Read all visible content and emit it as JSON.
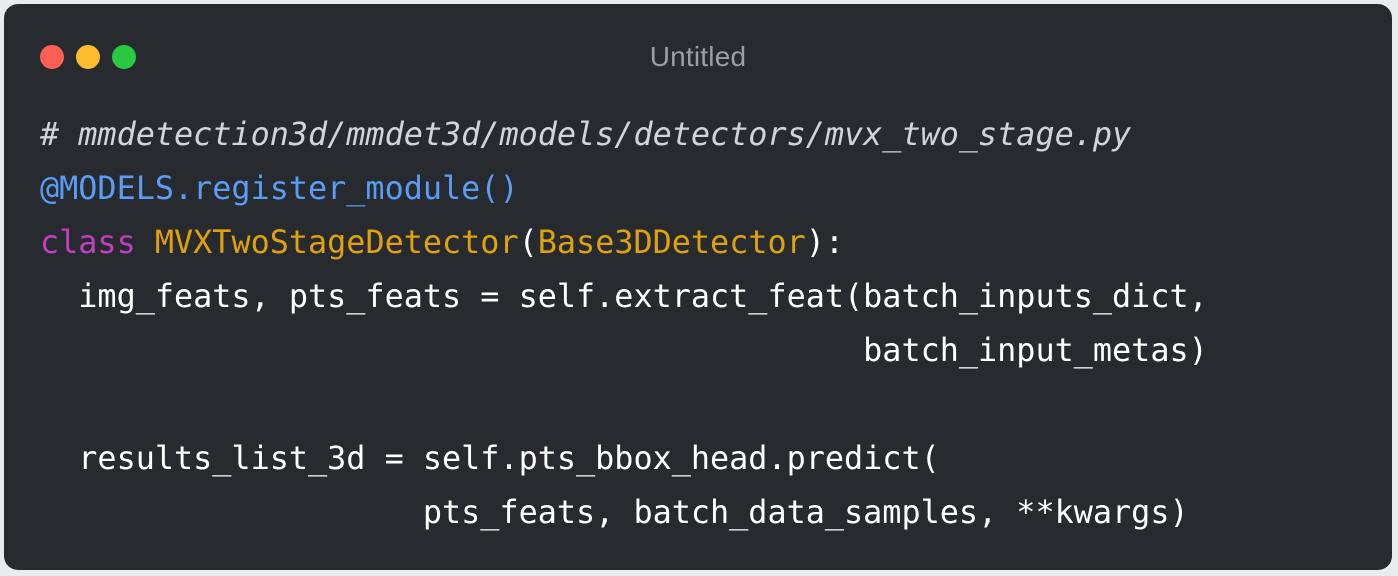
{
  "window": {
    "title": "Untitled",
    "controls": {
      "close_color": "#ff5f57",
      "minimize_color": "#febc2e",
      "maximize_color": "#28c840"
    }
  },
  "colors": {
    "background": "#272a2f",
    "comment": "#d1d5db",
    "decorator": "#5b9cf5",
    "keyword": "#c23ec2",
    "class_name": "#e0a20c",
    "plain": "#ffffff",
    "title": "#9aa0a6"
  },
  "code": {
    "language": "python",
    "lines": [
      {
        "tokens": [
          {
            "type": "comment",
            "text": "# mmdetection3d/mmdet3d/models/detectors/mvx_two_stage.py"
          }
        ]
      },
      {
        "tokens": [
          {
            "type": "decorator",
            "text": "@MODELS.register_module()"
          }
        ]
      },
      {
        "tokens": [
          {
            "type": "keyword",
            "text": "class"
          },
          {
            "type": "plain",
            "text": " "
          },
          {
            "type": "class",
            "text": "MVXTwoStageDetector"
          },
          {
            "type": "plain",
            "text": "("
          },
          {
            "type": "class",
            "text": "Base3DDetector"
          },
          {
            "type": "plain",
            "text": "):"
          }
        ]
      },
      {
        "tokens": [
          {
            "type": "plain",
            "text": "  img_feats, pts_feats = self.extract_feat(batch_inputs_dict,"
          }
        ]
      },
      {
        "tokens": [
          {
            "type": "plain",
            "text": "                                           batch_input_metas)"
          }
        ]
      },
      {
        "tokens": []
      },
      {
        "tokens": [
          {
            "type": "plain",
            "text": "  results_list_3d = self.pts_bbox_head.predict("
          }
        ]
      },
      {
        "tokens": [
          {
            "type": "plain",
            "text": "                    pts_feats, batch_data_samples, **kwargs)"
          }
        ]
      }
    ]
  }
}
